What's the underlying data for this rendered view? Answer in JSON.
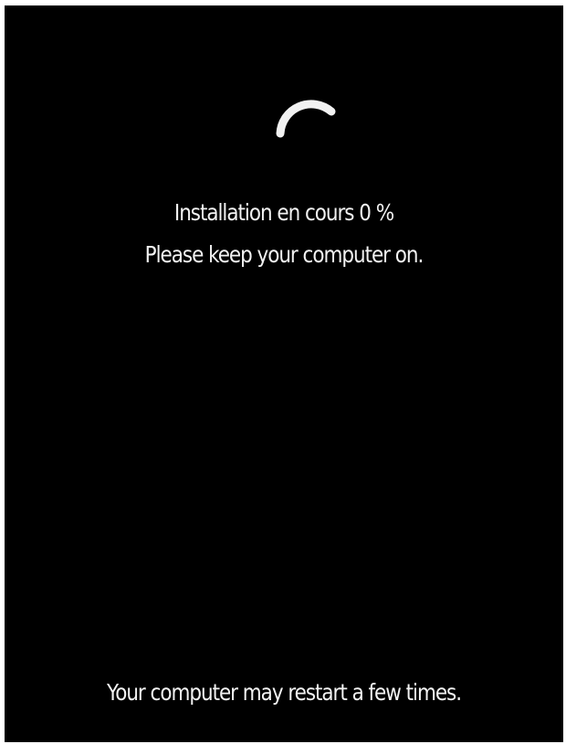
{
  "screen": {
    "progress_text": "Installation en cours 0 %",
    "progress_percent": 0,
    "keep_on_text": "Please keep your computer on.",
    "restart_note": "Your computer may restart a few times.",
    "spinner_icon": "loading-spinner-icon",
    "colors": {
      "background": "#000000",
      "text": "#f2f2f2"
    }
  }
}
